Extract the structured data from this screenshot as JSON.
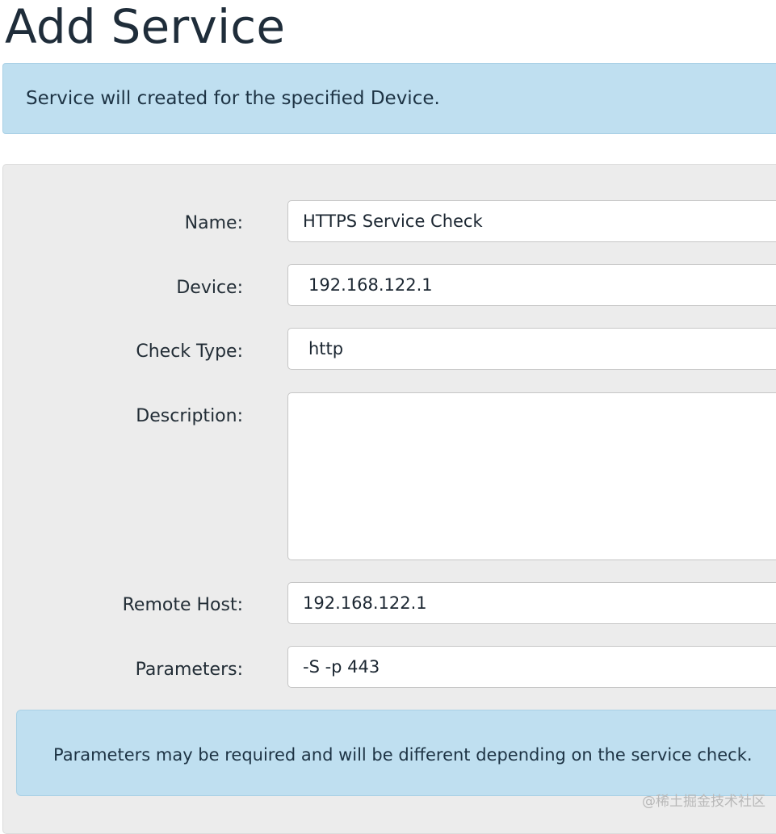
{
  "page": {
    "title": "Add Service"
  },
  "info_banner": {
    "text": "Service will created for the specified Device."
  },
  "form": {
    "name": {
      "label": "Name:",
      "value": "HTTPS Service Check"
    },
    "device": {
      "label": "Device:",
      "value": "192.168.122.1"
    },
    "check_type": {
      "label": "Check Type:",
      "value": "http"
    },
    "description": {
      "label": "Description:",
      "value": ""
    },
    "remote_host": {
      "label": "Remote Host:",
      "value": "192.168.122.1"
    },
    "parameters": {
      "label": "Parameters:",
      "value": "-S -p 443"
    }
  },
  "hint_banner": {
    "text": "Parameters may be required and will be different depending on the service check."
  },
  "watermark": {
    "text": "@稀土掘金技术社区"
  },
  "colors": {
    "banner_bg": "#bfdff0",
    "panel_bg": "#ececec",
    "title_text": "#1f2d3a"
  }
}
